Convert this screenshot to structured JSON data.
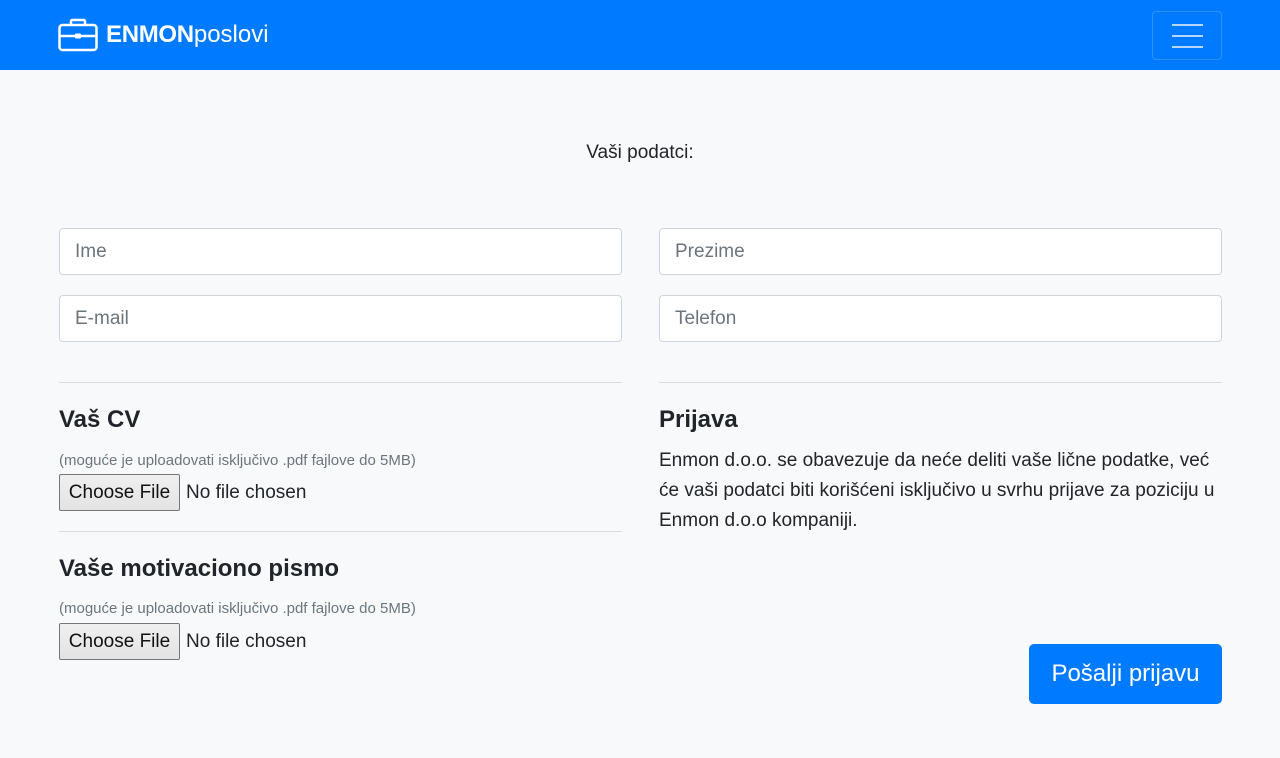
{
  "navbar": {
    "brand_bold": "ENMON",
    "brand_light": "poslovi",
    "brand_icon": "briefcase-icon",
    "menu_icon": "hamburger-menu-icon",
    "color": "#007bff"
  },
  "form": {
    "title": "Vaši podatci:",
    "fields": {
      "first_name_placeholder": "Ime",
      "last_name_placeholder": "Prezime",
      "email_placeholder": "E-mail",
      "phone_placeholder": "Telefon"
    }
  },
  "cv": {
    "title": "Vaš CV",
    "hint": "(moguće je uploadovati isključivo .pdf fajlove do 5MB)",
    "button_label": "Choose File",
    "status": "No file chosen"
  },
  "letter": {
    "title": "Vaše motivaciono pismo",
    "hint": "(moguće je uploadovati isključivo .pdf fajlove do 5MB)",
    "button_label": "Choose File",
    "status": "No file chosen"
  },
  "application": {
    "title": "Prijava",
    "text": "Enmon d.o.o. se obavezuje da neće deliti vaše lične podatke, već će vaši podatci biti korišćeni isključivo u svrhu prijave za poziciju u Enmon d.o.o kompaniji."
  },
  "submit": {
    "label": "Pošalji prijavu",
    "color": "#007bff"
  }
}
